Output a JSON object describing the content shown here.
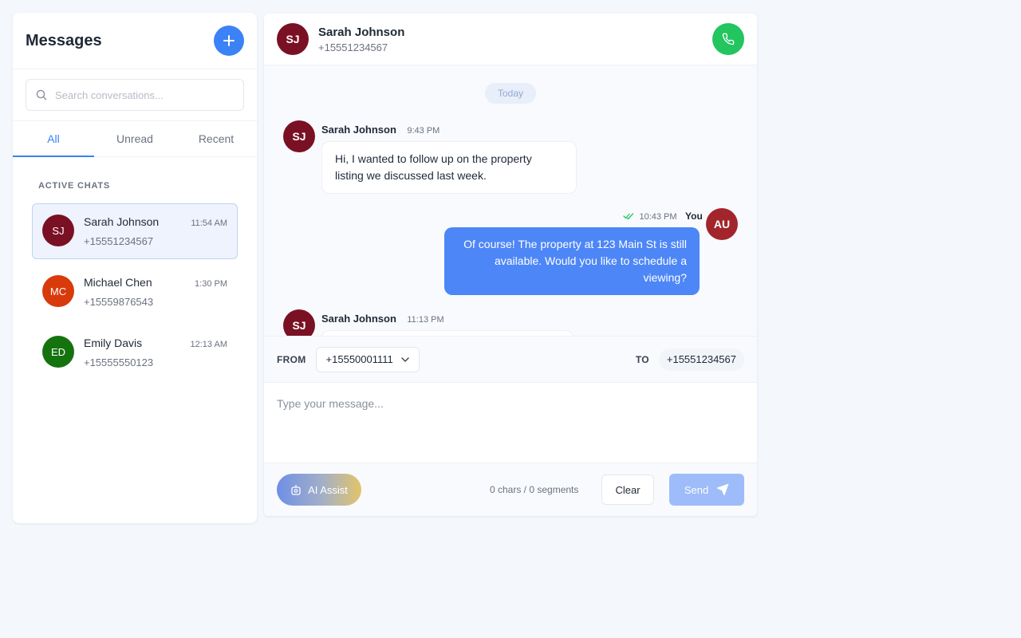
{
  "sidebar": {
    "title": "Messages",
    "new_icon": "plus-icon",
    "search_placeholder": "Search conversations...",
    "tabs": [
      {
        "label": "All",
        "active": true
      },
      {
        "label": "Unread",
        "active": false
      },
      {
        "label": "Recent",
        "active": false
      }
    ],
    "section_label": "ACTIVE CHATS",
    "conversations": [
      {
        "initials": "SJ",
        "name": "Sarah Johnson",
        "phone": "+15551234567",
        "time": "11:54 AM",
        "color": "#7a1024",
        "active": true
      },
      {
        "initials": "MC",
        "name": "Michael Chen",
        "phone": "+15559876543",
        "time": "1:30 PM",
        "color": "#d93a0b",
        "active": false
      },
      {
        "initials": "ED",
        "name": "Emily Davis",
        "phone": "+15555550123",
        "time": "12:13 AM",
        "color": "#15730f",
        "active": false
      }
    ]
  },
  "chat": {
    "header": {
      "initials": "SJ",
      "name": "Sarah Johnson",
      "phone": "+15551234567",
      "avatar_color": "#7a1024",
      "call_icon": "phone-icon",
      "call_color": "#22c55e"
    },
    "day_label": "Today",
    "messages": [
      {
        "direction": "in",
        "initials": "SJ",
        "sender": "Sarah Johnson",
        "time": "9:43 PM",
        "text": "Hi, I wanted to follow up on the property listing we discussed last week."
      },
      {
        "direction": "out",
        "initials": "AU",
        "sender": "You",
        "time": "10:43 PM",
        "status_icon": "double-check-icon",
        "text": "Of course! The property at 123 Main St is still available. Would you like to schedule a viewing?"
      },
      {
        "direction": "in",
        "initials": "SJ",
        "sender": "Sarah Johnson",
        "time": "11:13 PM",
        "text": ""
      }
    ],
    "from_label": "FROM",
    "from_value": "+15550001111",
    "to_label": "TO",
    "to_value": "+15551234567",
    "composer_placeholder": "Type your message...",
    "ai_label": "AI Assist",
    "counter": "0 chars / 0 segments",
    "clear_label": "Clear",
    "send_label": "Send",
    "accent_color": "#3b82f6"
  }
}
